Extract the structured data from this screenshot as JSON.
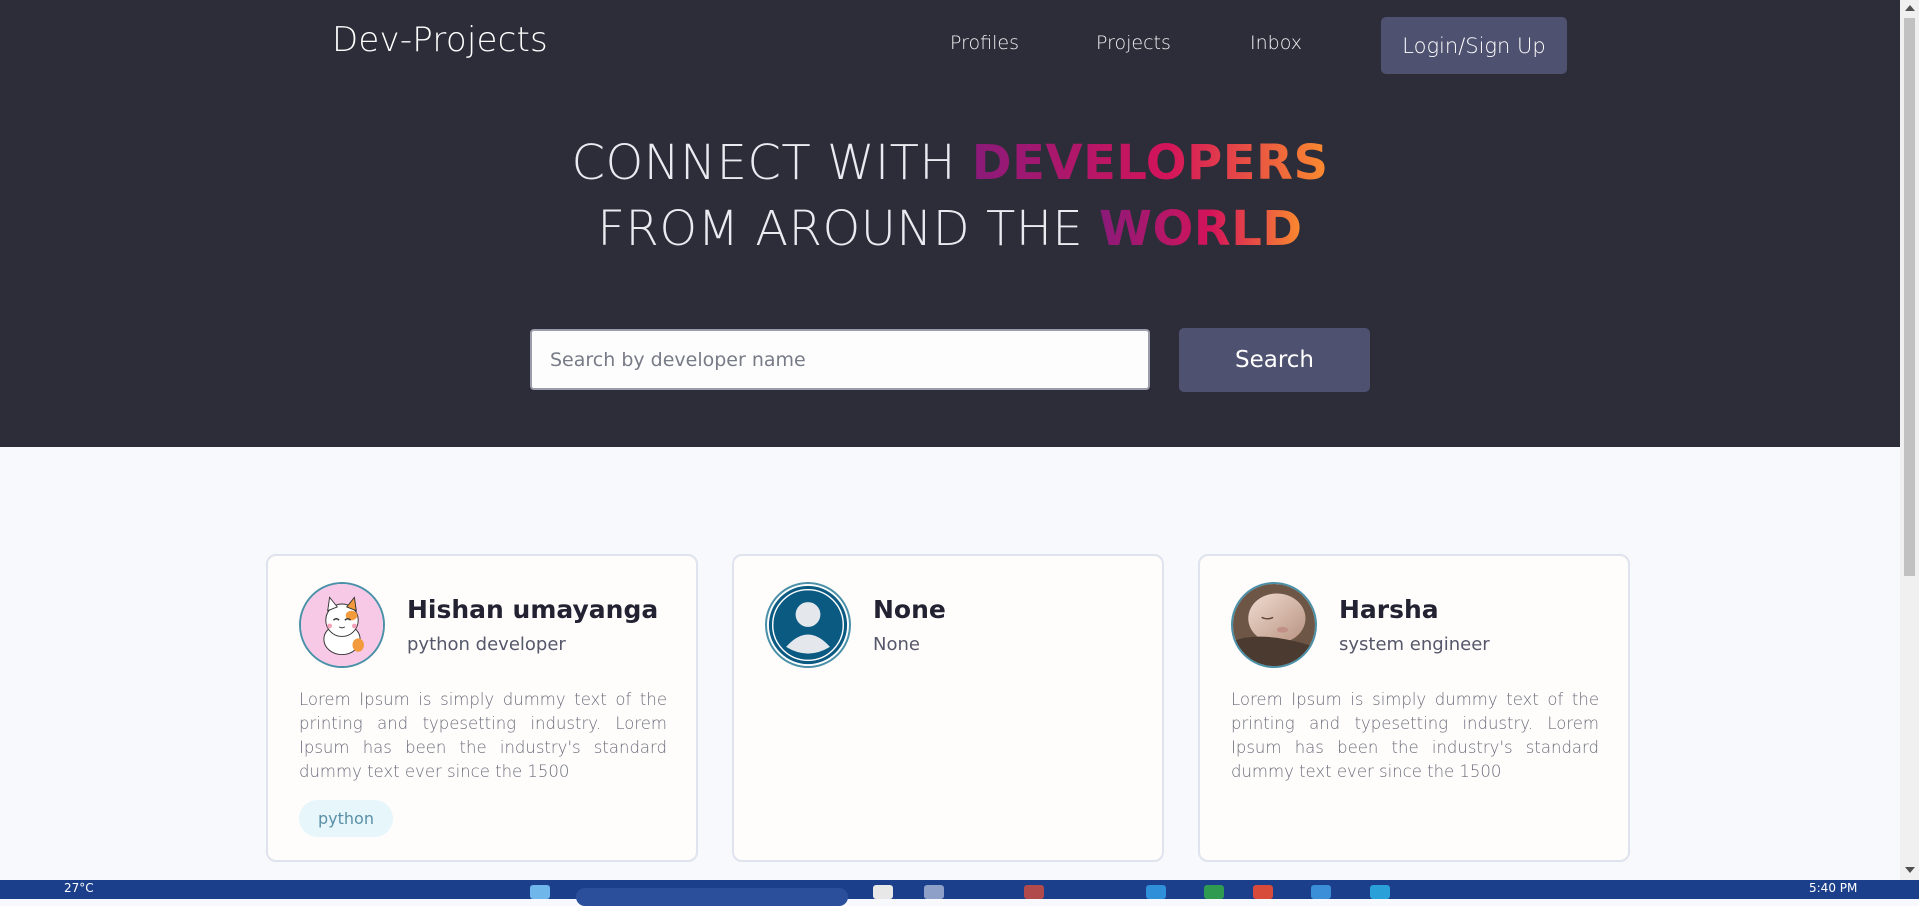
{
  "header": {
    "logo": "Dev-Projects",
    "nav": [
      "Profiles",
      "Projects",
      "Inbox"
    ],
    "login_label": "Login/Sign Up"
  },
  "hero": {
    "line1_plain": "CONNECT WITH ",
    "line1_highlight": "DEVELOPERS",
    "line2_plain": "FROM AROUND THE ",
    "line2_highlight": "WORLD"
  },
  "search": {
    "placeholder": "Search by developer name",
    "button_label": "Search"
  },
  "profiles": [
    {
      "name": "Hishan umayanga",
      "role": "python developer",
      "bio": "Lorem Ipsum is simply dummy text of the printing and typesetting industry. Lorem Ipsum has been the industry's standard dummy text ever since the 1500",
      "tags": [
        "python"
      ],
      "avatar": "cat-avatar-icon"
    },
    {
      "name": "None",
      "role": "None",
      "bio": "",
      "tags": [],
      "avatar": "default-user-icon"
    },
    {
      "name": "Harsha",
      "role": "system engineer",
      "bio": "Lorem Ipsum is simply dummy text of the printing and typesetting industry. Lorem Ipsum has been the industry's standard dummy text ever since the 1500",
      "tags": [],
      "avatar": "photo-avatar"
    }
  ],
  "taskbar": {
    "temperature": "27°C",
    "clock": "5:40 PM"
  },
  "colors": {
    "header_bg": "#2d2d39",
    "button_bg": "#4f5170",
    "gradient": [
      "#8a1a7a",
      "#d4145a",
      "#fb8c2e"
    ],
    "page_bg": "#f7f9fc",
    "taskbar_bg": "#1c3f8c"
  }
}
